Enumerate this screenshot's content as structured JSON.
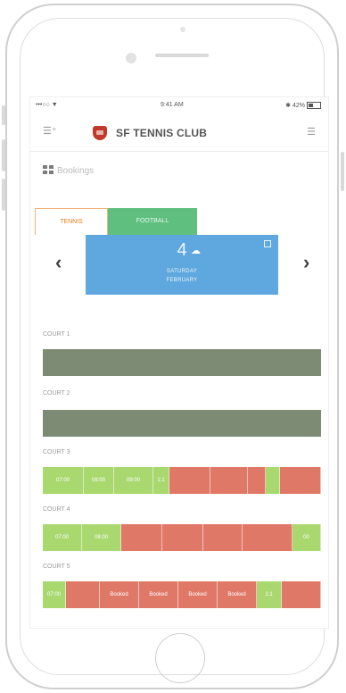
{
  "statusbar": {
    "carrier": "•••○○ ▼",
    "time": "9:41 AM",
    "battery": "✱ 42%"
  },
  "appbar": {
    "title": "SF TENNIS CLUB"
  },
  "section": {
    "title": "Bookings"
  },
  "tabs": [
    {
      "label": "TENNIS",
      "active": true
    },
    {
      "label": "FOOTBALL",
      "active": false
    }
  ],
  "day": {
    "number": "4",
    "weekday": "SATURDAY",
    "month": "FEBRUARY"
  },
  "nav": {
    "prev": "‹",
    "next": "›"
  },
  "colors": {
    "free": "#a9d86f",
    "booked": "#e07868",
    "closed": "#7d8a74",
    "accent": "#5fa8df",
    "tab_active": "#e67e22",
    "tab_other": "#5fbf7f"
  },
  "courts": [
    {
      "label": "COURT 1"
    },
    {
      "label": "COURT 2"
    },
    {
      "label": "COURT 3",
      "slots": [
        {
          "text": "07:00",
          "status": "free"
        },
        {
          "text": "08:00",
          "status": "free"
        },
        {
          "text": "09:00",
          "status": "free"
        },
        {
          "text": "1:1",
          "status": "free"
        },
        {
          "text": "",
          "status": "booked"
        },
        {
          "text": "",
          "status": "booked"
        },
        {
          "text": "",
          "status": "booked"
        },
        {
          "text": "",
          "status": "free"
        },
        {
          "text": "",
          "status": "booked"
        }
      ]
    },
    {
      "label": "COURT 4",
      "slots": [
        {
          "text": "07:00",
          "status": "free"
        },
        {
          "text": "08:00",
          "status": "free"
        },
        {
          "text": "",
          "status": "booked"
        },
        {
          "text": "",
          "status": "booked"
        },
        {
          "text": "",
          "status": "booked"
        },
        {
          "text": "",
          "status": "booked"
        },
        {
          "text": "00",
          "status": "free"
        }
      ]
    },
    {
      "label": "COURT 5",
      "slots": [
        {
          "text": "07:00",
          "status": "free"
        },
        {
          "text": "",
          "status": "booked"
        },
        {
          "text": "Booked",
          "status": "booked"
        },
        {
          "text": "Booked",
          "status": "booked"
        },
        {
          "text": "Booked",
          "status": "booked"
        },
        {
          "text": "Booked",
          "status": "booked"
        },
        {
          "text": "1:1",
          "status": "free"
        },
        {
          "text": "",
          "status": "booked"
        }
      ]
    }
  ]
}
